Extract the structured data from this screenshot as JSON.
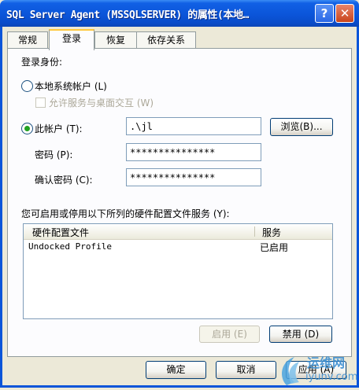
{
  "window": {
    "title": "SQL Server Agent (MSSQLSERVER) 的属性(本地…",
    "help_glyph": "?",
    "close_glyph": "✕"
  },
  "tabs": [
    {
      "label": "常规",
      "active": false
    },
    {
      "label": "登录",
      "active": true
    },
    {
      "label": "恢复",
      "active": false
    },
    {
      "label": "依存关系",
      "active": false
    }
  ],
  "logon": {
    "section_label": "登录身份:",
    "local_system": {
      "label": "本地系统帐户 (L)",
      "selected": false
    },
    "interact_desktop": {
      "label": "允许服务与桌面交互 (W)",
      "checked": false,
      "enabled": false
    },
    "this_account": {
      "label": "此帐户 (T):",
      "selected": true
    },
    "account_value": ".\\jl",
    "browse_label": "浏览(B)...",
    "password_label": "密码 (P):",
    "password_value": "***************",
    "confirm_label": "确认密码 (C):",
    "confirm_value": "***************"
  },
  "profiles": {
    "caption": "您可启用或停用以下所列的硬件配置文件服务 (Y):",
    "columns": [
      "硬件配置文件",
      "服务"
    ],
    "rows": [
      {
        "profile": "Undocked Profile",
        "service": "已启用"
      }
    ],
    "enable_label": "启用 (E)",
    "disable_label": "禁用 (D)"
  },
  "footer": {
    "ok_label": "确定",
    "cancel_label": "取消",
    "apply_label": "应用 (A)"
  },
  "watermark": {
    "line1": "运维网",
    "line2": "iyunv.com"
  },
  "colors": {
    "titlebar": "#0b55d9",
    "dialog_bg": "#ece9d8",
    "radio_dot": "#21a121",
    "active_tab_accent": "#ffc83c"
  }
}
